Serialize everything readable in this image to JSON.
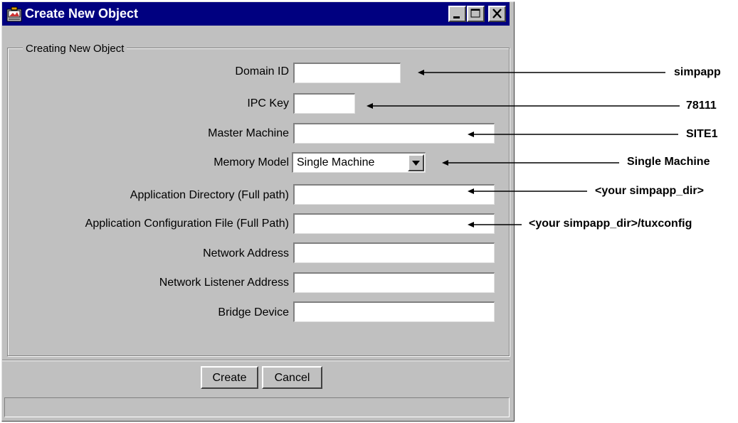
{
  "window": {
    "title": "Create New Object",
    "controls": {
      "minimize": "minimize-icon",
      "maximize": "maximize-icon",
      "close": "close-icon"
    }
  },
  "group": {
    "title": "Creating New Object",
    "fields": [
      {
        "label": "Domain ID",
        "value": ""
      },
      {
        "label": "IPC Key",
        "value": ""
      },
      {
        "label": "Master Machine",
        "value": ""
      },
      {
        "label": "Memory Model",
        "selected": "Single Machine"
      },
      {
        "label": "Application Directory (Full path)",
        "value": ""
      },
      {
        "label": "Application Configuration File (Full Path)",
        "value": ""
      },
      {
        "label": "Network Address",
        "value": ""
      },
      {
        "label": "Network Listener Address",
        "value": ""
      },
      {
        "label": "Bridge Device",
        "value": ""
      }
    ]
  },
  "buttons": {
    "create": "Create",
    "cancel": "Cancel"
  },
  "status": "",
  "annotations": [
    "simpapp",
    "78111",
    "SITE1",
    "Single Machine",
    "<your simpapp_dir>",
    "<your simpapp_dir>/tuxconfig"
  ],
  "colors": {
    "titlebar": "#000080",
    "face": "#c0c0c0",
    "field": "#ffffff"
  }
}
